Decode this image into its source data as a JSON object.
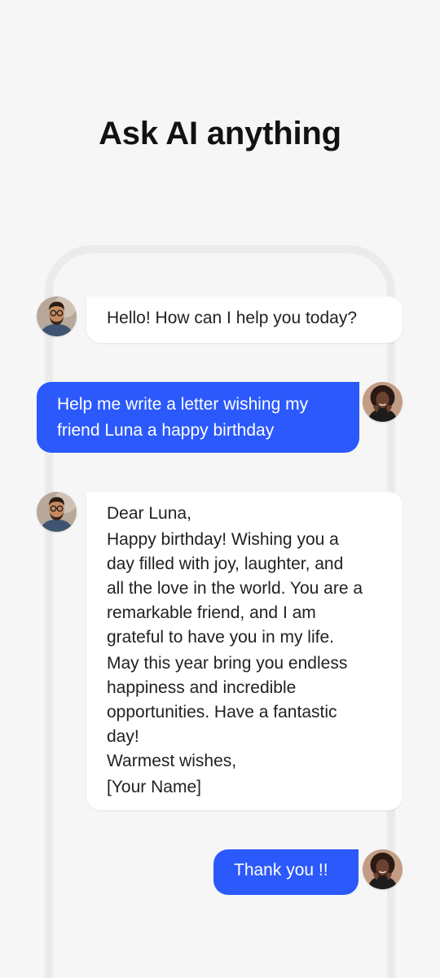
{
  "header": {
    "title": "Ask AI anything"
  },
  "chat": {
    "messages": [
      {
        "role": "assistant",
        "avatar_icon": "man-with-glasses-avatar",
        "lines": [
          "Hello! How can I help you today?"
        ]
      },
      {
        "role": "user",
        "avatar_icon": "woman-avatar",
        "lines": [
          "Help me write a letter wishing my",
          "friend Luna a happy birthday"
        ]
      },
      {
        "role": "assistant",
        "avatar_icon": "man-with-glasses-avatar",
        "lines": [
          "Dear Luna,",
          "Happy birthday! Wishing you a",
          "day filled with joy, laughter, and",
          "all the love in the world. You are a",
          "remarkable friend, and I am",
          "grateful to have you in my life.",
          "May this year bring you endless",
          "happiness and incredible",
          "opportunities. Have a fantastic",
          "day!",
          "Warmest wishes,",
          "[Your Name]"
        ]
      },
      {
        "role": "user",
        "avatar_icon": "woman-avatar",
        "lines": [
          "Thank you !!"
        ]
      }
    ]
  },
  "colors": {
    "background": "#f6f6f6",
    "user_bubble": "#2b59fc",
    "assistant_bubble": "#ffffff",
    "frame": "#ebebeb"
  }
}
